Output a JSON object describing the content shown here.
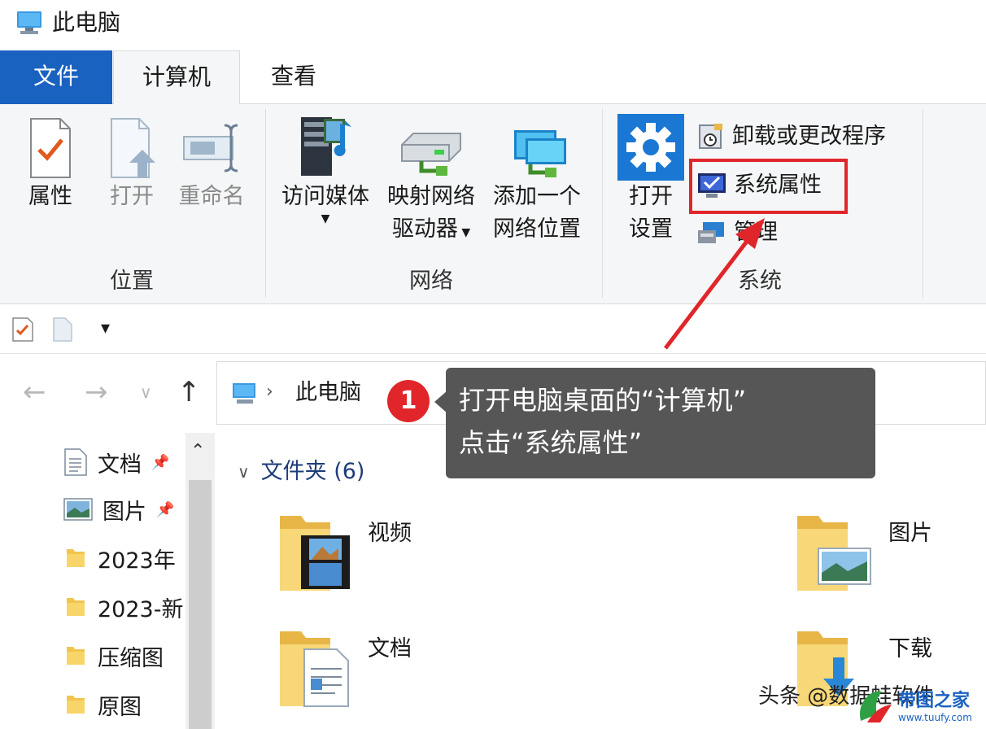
{
  "window": {
    "title": "此电脑"
  },
  "ribbon_tabs": {
    "file": "文件",
    "computer": "计算机",
    "view": "查看"
  },
  "ribbon": {
    "location_group": {
      "label": "位置",
      "properties": "属性",
      "open": "打开",
      "rename": "重命名"
    },
    "network_group": {
      "label": "网络",
      "access_media": "访问媒体",
      "map_drive_1": "映射网络",
      "map_drive_2": "驱动器",
      "add_location_1": "添加一个",
      "add_location_2": "网络位置"
    },
    "system_group": {
      "label": "系统",
      "open_settings_1": "打开",
      "open_settings_2": "设置",
      "uninstall": "卸载或更改程序",
      "system_properties": "系统属性",
      "manage": "管理"
    }
  },
  "address_bar": {
    "crumb": "此电脑"
  },
  "sidebar": {
    "items": [
      {
        "label": "文档",
        "icon": "document-icon"
      },
      {
        "label": "图片",
        "icon": "pictures-icon"
      },
      {
        "label": "2023年",
        "icon": "folder-icon"
      },
      {
        "label": "2023-新",
        "icon": "folder-icon"
      },
      {
        "label": "压缩图",
        "icon": "folder-icon"
      },
      {
        "label": "原图",
        "icon": "folder-icon"
      }
    ]
  },
  "content": {
    "section_title": "文件夹 (6)",
    "folders": [
      "视频",
      "图片",
      "文档",
      "下载"
    ]
  },
  "annotation": {
    "badge": "1",
    "line1": "打开电脑桌面的“计算机”",
    "line2": "点击“系统属性”"
  },
  "watermark": {
    "text": "头条 @数据蛙软件",
    "site_name": "带图之家",
    "site_url": "www.tuufy.com"
  },
  "colors": {
    "file_tab": "#1a62c0",
    "highlight_red": "#e0262a",
    "callout_bg": "#565656"
  }
}
